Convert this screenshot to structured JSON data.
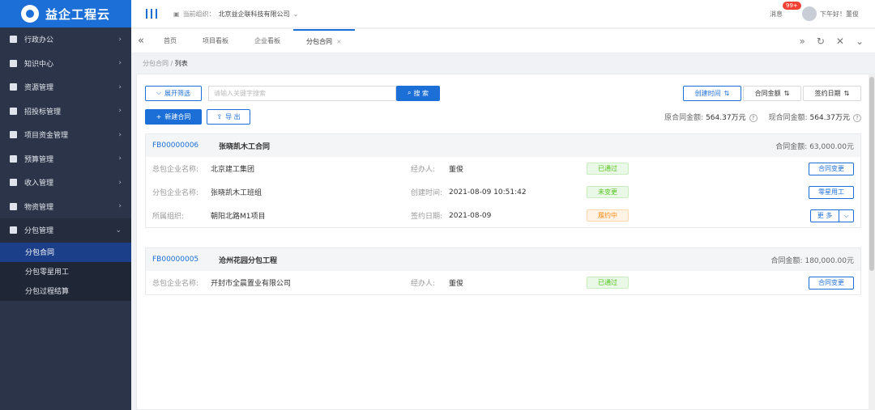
{
  "app": {
    "logo_text": "益企工程云"
  },
  "sidebar": {
    "items": [
      {
        "label": "行政办公"
      },
      {
        "label": "知识中心"
      },
      {
        "label": "资源管理"
      },
      {
        "label": "招投标管理"
      },
      {
        "label": "项目资金管理"
      },
      {
        "label": "预算管理"
      },
      {
        "label": "收入管理"
      },
      {
        "label": "物资管理"
      },
      {
        "label": "分包管理"
      }
    ],
    "sub_items": [
      {
        "label": "分包合同"
      },
      {
        "label": "分包零星用工"
      },
      {
        "label": "分包过程结算"
      }
    ]
  },
  "header": {
    "company_prefix": "当前组织：",
    "company_name": "北京益企联科技有限公司",
    "msg_label": "消息",
    "msg_count": "99+",
    "greeting": "下午好！董俊"
  },
  "tabs": [
    {
      "label": "首页"
    },
    {
      "label": "项目看板"
    },
    {
      "label": "企业看板"
    },
    {
      "label": "分包合同"
    }
  ],
  "breadcrumb": {
    "parent": "分包合同",
    "sep": "/",
    "current": "列表"
  },
  "toolbar": {
    "expand_filter": "展开筛选",
    "search_placeholder": "请输入关键字搜索",
    "search_button": "搜 索",
    "sort_created": "创建时间",
    "sort_amount": "合同金额",
    "sort_signed": "签约日期",
    "new_contract": "新建合同",
    "export": "导 出",
    "original_total_label": "原合同金额:",
    "original_total_value": "564.37万元",
    "current_total_label": "现合同金额:",
    "current_total_value": "564.37万元"
  },
  "cards": [
    {
      "code": "FB00000006",
      "title": "张晓凯木工合同",
      "amount_label": "合同金额:",
      "amount": "63,000.00元",
      "rows": [
        {
          "l1": "总包企业名称:",
          "v1": "北京建工集团",
          "l2": "经办人:",
          "v2": "董俊",
          "status": "已通过",
          "action": "合同变更"
        },
        {
          "l1": "分包企业名称:",
          "v1": "张晓凯木工班组",
          "l2": "创建时间:",
          "v2": "2021-08-09 10:51:42",
          "status": "未变更",
          "action": "零星用工"
        },
        {
          "l1": "所属组织:",
          "v1": "朝阳北路M1项目",
          "l2": "签约日期:",
          "v2": "2021-08-09",
          "status": "履约中",
          "action": "更 多"
        }
      ]
    },
    {
      "code": "FB00000005",
      "title": "沧州花园分包工程",
      "amount_label": "合同金额:",
      "amount": "180,000.00元",
      "rows": [
        {
          "l1": "总包企业名称:",
          "v1": "开封市全晨置业有限公司",
          "l2": "经办人:",
          "v2": "董俊",
          "status": "已通过",
          "action": "合同变更"
        }
      ]
    }
  ]
}
